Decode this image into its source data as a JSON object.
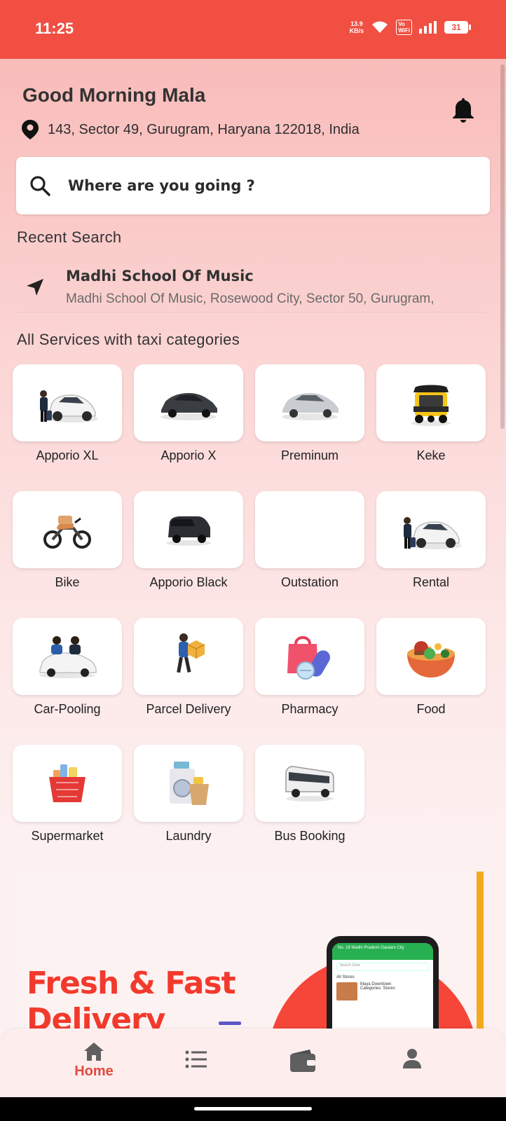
{
  "status_bar": {
    "time": "11:25",
    "net_speed_value": "13.9",
    "net_speed_unit": "KB/s",
    "volte_top": "Vo",
    "volte_bottom": "WiFi",
    "battery": "31"
  },
  "header": {
    "greeting": "Good Morning Mala",
    "address": "143, Sector 49, Gurugram, Haryana 122018, India"
  },
  "search": {
    "placeholder": "Where are you going ?"
  },
  "recent": {
    "title": "Recent Search",
    "items": [
      {
        "name": "Madhi School Of Music",
        "address": "Madhi School Of Music, Rosewood City, Sector 50, Gurugram,"
      }
    ]
  },
  "services": {
    "title": "All Services with taxi categories",
    "items": [
      {
        "label": "Apporio XL",
        "icon": "car-with-driver-icon"
      },
      {
        "label": "Apporio X",
        "icon": "dark-sedan-icon"
      },
      {
        "label": "Preminum",
        "icon": "silver-sedan-icon"
      },
      {
        "label": "Keke",
        "icon": "auto-rickshaw-icon"
      },
      {
        "label": "Bike",
        "icon": "motorbike-icon"
      },
      {
        "label": "Apporio Black",
        "icon": "black-van-icon"
      },
      {
        "label": "Outstation",
        "icon": ""
      },
      {
        "label": "Rental",
        "icon": "car-with-driver-icon"
      },
      {
        "label": "Car-Pooling",
        "icon": "carpool-icon"
      },
      {
        "label": "Parcel Delivery",
        "icon": "delivery-person-icon"
      },
      {
        "label": "Pharmacy",
        "icon": "pharmacy-bag-icon"
      },
      {
        "label": "Food",
        "icon": "food-bowl-icon"
      },
      {
        "label": "Supermarket",
        "icon": "grocery-basket-icon"
      },
      {
        "label": "Laundry",
        "icon": "laundry-icon"
      },
      {
        "label": "Bus Booking",
        "icon": "bus-icon"
      }
    ]
  },
  "banner": {
    "headline_line1": "Fresh & Fast",
    "headline_line2": "Delivery",
    "phone_header": "No. 18 Madhi Pradesh Gautam City",
    "phone_search": "Search Store",
    "phone_section": "All Stores",
    "phone_store_name": "Maya Downtown",
    "phone_store_sub": "Categories: Stores"
  },
  "bottom_nav": {
    "items": [
      {
        "label": "Home",
        "icon": "home-icon",
        "active": true
      },
      {
        "label": "",
        "icon": "list-icon",
        "active": false
      },
      {
        "label": "",
        "icon": "wallet-icon",
        "active": false
      },
      {
        "label": "",
        "icon": "profile-icon",
        "active": false
      }
    ]
  },
  "colors": {
    "primary": "#F04F42",
    "accent": "#F4A91F"
  }
}
